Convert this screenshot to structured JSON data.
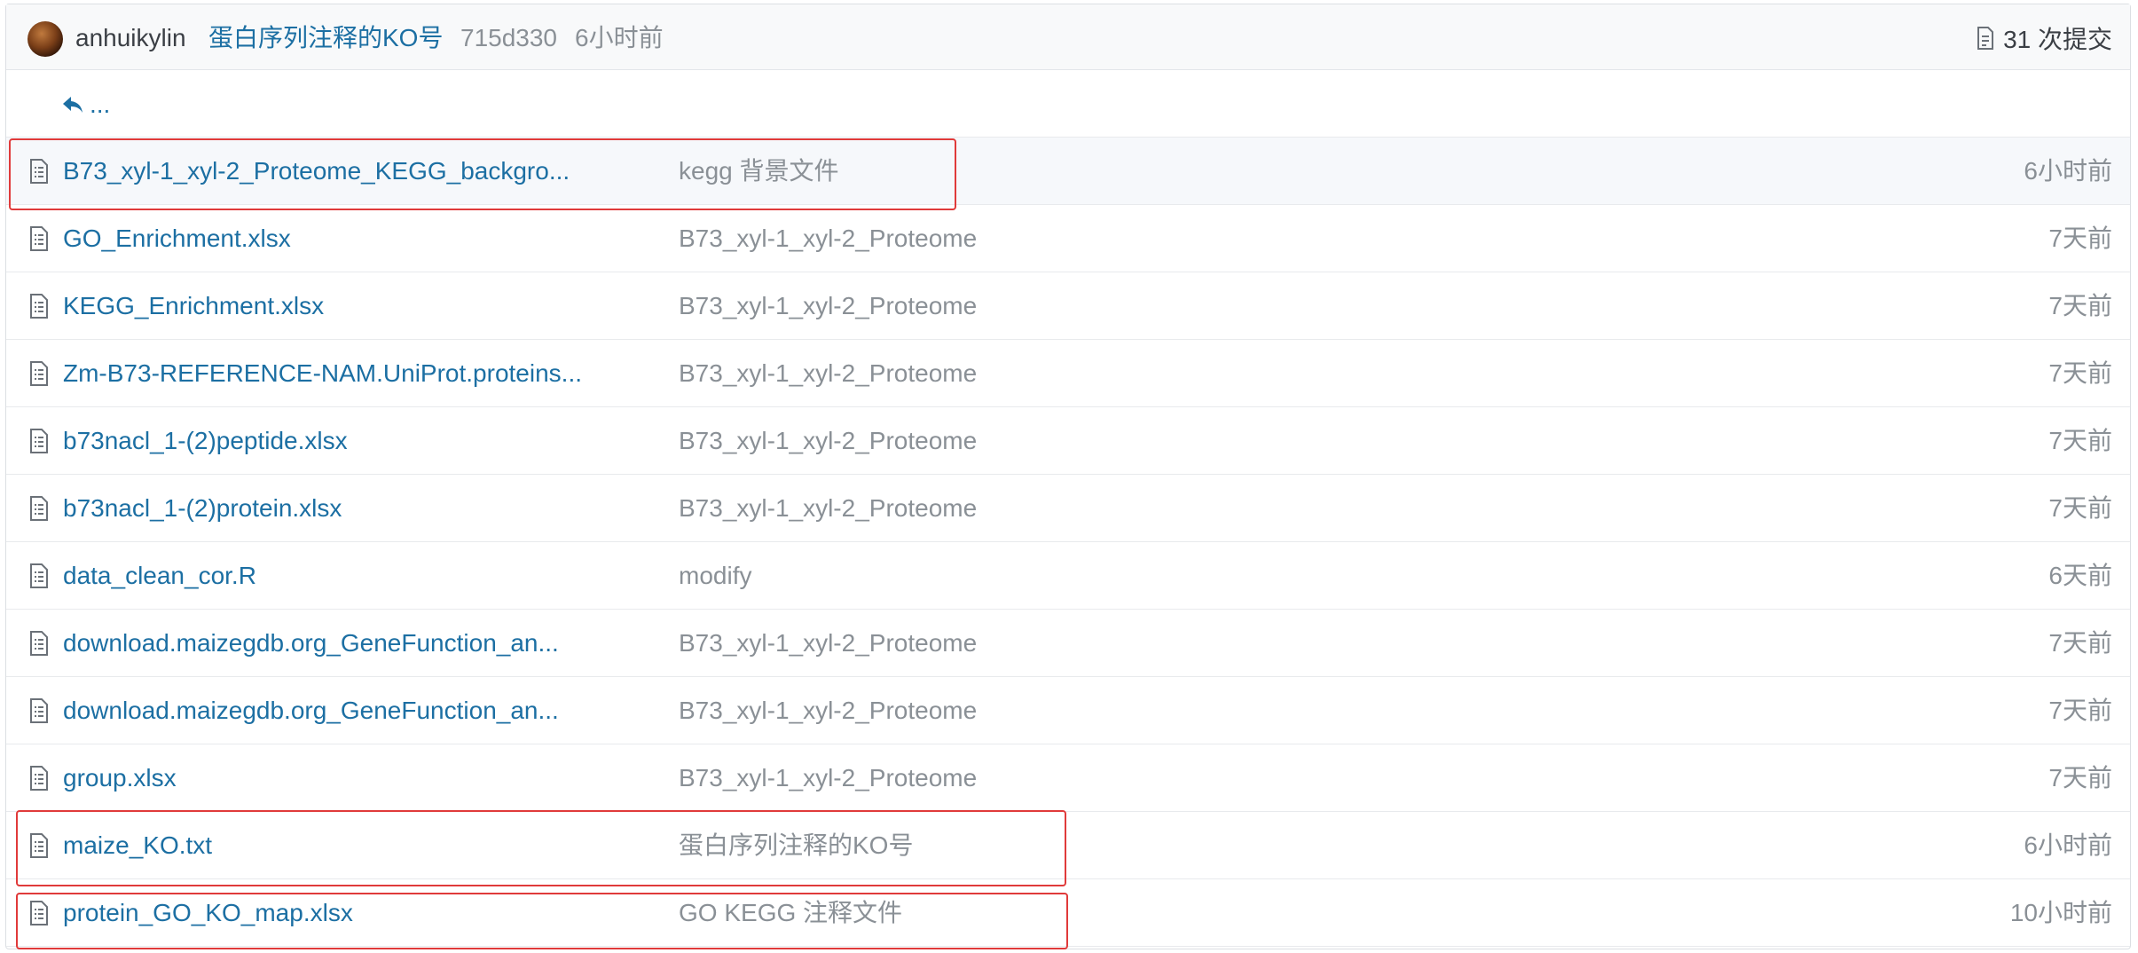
{
  "header": {
    "author": "anhuikylin",
    "commit_message": "蛋白序列注释的KO号",
    "commit_sha": "715d330",
    "commit_time": "6小时前",
    "commits_label": "31 次提交"
  },
  "parent_dir_label": "...",
  "files": [
    {
      "name": "B73_xyl-1_xyl-2_Proteome_KEGG_backgro...",
      "message": "kegg 背景文件",
      "time": "6小时前"
    },
    {
      "name": "GO_Enrichment.xlsx",
      "message": "B73_xyl-1_xyl-2_Proteome",
      "time": "7天前"
    },
    {
      "name": "KEGG_Enrichment.xlsx",
      "message": "B73_xyl-1_xyl-2_Proteome",
      "time": "7天前"
    },
    {
      "name": "Zm-B73-REFERENCE-NAM.UniProt.proteins...",
      "message": "B73_xyl-1_xyl-2_Proteome",
      "time": "7天前"
    },
    {
      "name": "b73nacl_1-(2)peptide.xlsx",
      "message": "B73_xyl-1_xyl-2_Proteome",
      "time": "7天前"
    },
    {
      "name": "b73nacl_1-(2)protein.xlsx",
      "message": "B73_xyl-1_xyl-2_Proteome",
      "time": "7天前"
    },
    {
      "name": "data_clean_cor.R",
      "message": "modify",
      "time": "6天前"
    },
    {
      "name": "download.maizegdb.org_GeneFunction_an...",
      "message": "B73_xyl-1_xyl-2_Proteome",
      "time": "7天前"
    },
    {
      "name": "download.maizegdb.org_GeneFunction_an...",
      "message": "B73_xyl-1_xyl-2_Proteome",
      "time": "7天前"
    },
    {
      "name": "group.xlsx",
      "message": "B73_xyl-1_xyl-2_Proteome",
      "time": "7天前"
    },
    {
      "name": "maize_KO.txt",
      "message": "蛋白序列注释的KO号",
      "time": "6小时前"
    },
    {
      "name": "protein_GO_KO_map.xlsx",
      "message": "GO KEGG 注释文件",
      "time": "10小时前"
    }
  ],
  "icons": {
    "file": "file-text-icon",
    "parent": "reply-arrow-icon",
    "commits": "document-icon"
  },
  "colors": {
    "link": "#1c6fa3",
    "muted": "#8a9096",
    "highlight_box": "#e03a3a"
  }
}
